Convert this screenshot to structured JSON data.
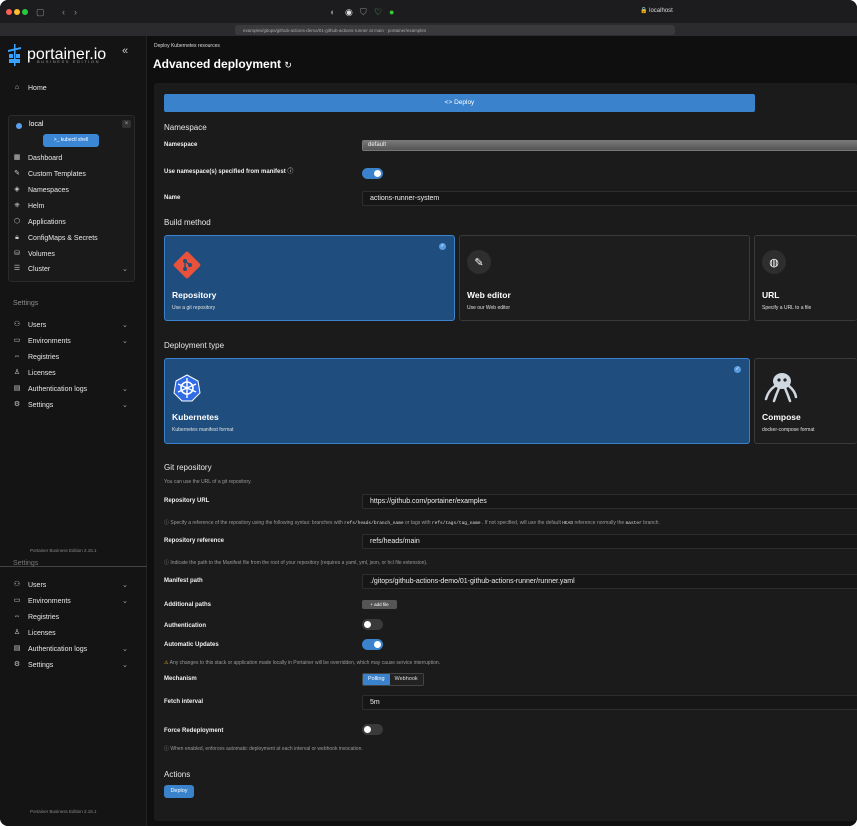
{
  "browser": {
    "url": "localhost",
    "tab_title": "examples/gitops/github-actions-demo/01-github-actions-runner at main · portainer/examples"
  },
  "sidebar": {
    "logo": "portainer.io",
    "logo_sub": "BUSINESS EDITION",
    "collapse": "«",
    "home": "Home",
    "environment": {
      "name": "local",
      "close": "×",
      "shell_button": ">_ kubectl shell",
      "items": [
        "Dashboard",
        "Custom Templates",
        "Namespaces",
        "Helm",
        "Applications",
        "ConfigMaps & Secrets",
        "Volumes",
        "Cluster"
      ]
    },
    "settings_title": "Settings",
    "settings_items": [
      "Users",
      "Environments",
      "Registries",
      "Licenses",
      "Authentication logs",
      "Settings"
    ],
    "settings_title_2": "Settings",
    "settings_items_2": [
      "Users",
      "Environments",
      "Registries",
      "Licenses",
      "Authentication logs",
      "Settings"
    ],
    "footer": "Portainer Business Edition 2.15.1",
    "footer_2": "Portainer Business Edition 2.15.1"
  },
  "header": {
    "breadcrumb": "Deploy Kubernetes resources",
    "title": "Advanced deployment",
    "refresh_icon": "↻"
  },
  "form": {
    "deploy_bar": "<> Deploy",
    "namespace_heading": "Namespace",
    "namespace_label": "Namespace",
    "namespace_value": "default",
    "use_ns_label": "Use namespace(s) specified from manifest",
    "name_label": "Name",
    "name_value": "actions-runner-system",
    "build_heading": "Build method",
    "build_cards": [
      {
        "title": "Repository",
        "sub": "Use a git repository"
      },
      {
        "title": "Web editor",
        "sub": "Use our Web editor"
      },
      {
        "title": "URL",
        "sub": "Specify a URL to a file"
      }
    ],
    "deploy_type_heading": "Deployment type",
    "deploy_cards": [
      {
        "title": "Kubernetes",
        "sub": "Kubernetes manifest format"
      },
      {
        "title": "Compose",
        "sub": "docker-compose format"
      }
    ],
    "git_heading": "Git repository",
    "git_hint": "You can use the URL of a git repository.",
    "repo_url_label": "Repository URL",
    "repo_url_value": "https://github.com/portainer/examples",
    "ref_hint_1": "Specify a reference of the repository using the following syntax: branches with",
    "ref_hint_code1": "refs/heads/branch_name",
    "ref_hint_2": "or tags with",
    "ref_hint_code2": "refs/tags/tag_name",
    "ref_hint_3": ". If not specified, will use the default",
    "ref_hint_code3": "HEAD",
    "ref_hint_4": "reference normally the",
    "ref_hint_code4": "master",
    "ref_hint_5": "branch.",
    "repo_ref_label": "Repository reference",
    "repo_ref_value": "refs/heads/main",
    "path_hint": "Indicate the path to the Manifest file from the root of your repository (requires a yaml, yml, json, or hcl file extension).",
    "manifest_label": "Manifest path",
    "manifest_value": "./gitops/github-actions-demo/01-github-actions-runner/runner.yaml",
    "additional_label": "Additional paths",
    "add_file": "+ add file",
    "auth_label": "Authentication",
    "auto_label": "Automatic Updates",
    "auto_warn": "Any changes to this stack or application made locally in Portainer will be overridden, which may cause service interruption.",
    "mechanism_label": "Mechanism",
    "mech_polling": "Polling",
    "mech_webhook": "Webhook",
    "fetch_label": "Fetch interval",
    "fetch_value": "5m",
    "force_label": "Force Redeployment",
    "force_hint": "When enabled, enforces automatic deployment at each interval or webhook invocation.",
    "actions_heading": "Actions",
    "deploy_button": "Deploy"
  }
}
